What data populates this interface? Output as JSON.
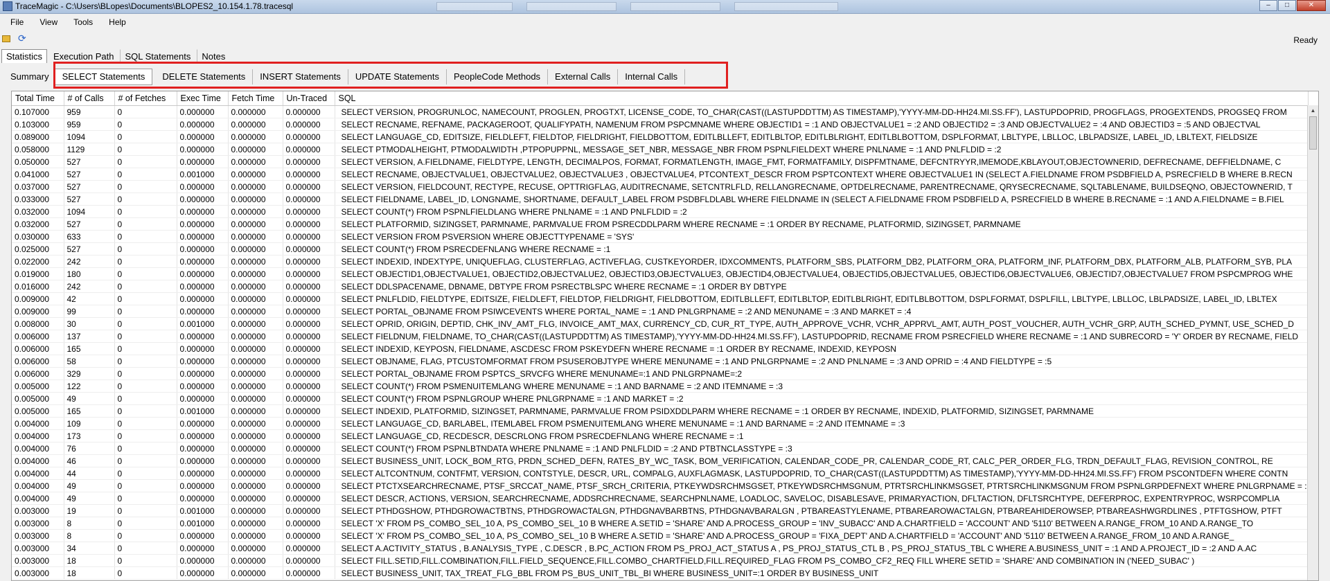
{
  "window": {
    "title": "TraceMagic - C:\\Users\\BLopes\\Documents\\BLOPES2_10.154.1.78.tracesql",
    "minimize": "–",
    "maximize": "□",
    "close": "✕"
  },
  "menu": [
    "File",
    "View",
    "Tools",
    "Help"
  ],
  "toolbar": {
    "open_icon": "folder-icon",
    "refresh_icon": "refresh-icon",
    "refresh_glyph": "⟳",
    "status": "Ready"
  },
  "top_tabs": [
    "Statistics",
    "Execution Path",
    "SQL Statements",
    "Notes"
  ],
  "sub_tabs": [
    "Summary",
    "SELECT Statements",
    "DELETE Statements",
    "INSERT Statements",
    "UPDATE Statements",
    "PeopleCode Methods",
    "External Calls",
    "Internal Calls"
  ],
  "grid": {
    "columns": [
      "Total Time",
      "# of Calls",
      "# of Fetches",
      "Exec Time",
      "Fetch Time",
      "Un-Traced",
      "SQL"
    ],
    "rows": [
      [
        "0.107000",
        "959",
        "0",
        "0.000000",
        "0.000000",
        "0.000000",
        "SELECT VERSION, PROGRUNLOC, NAMECOUNT, PROGLEN, PROGTXT, LICENSE_CODE, TO_CHAR(CAST((LASTUPDDTTM) AS TIMESTAMP),'YYYY-MM-DD-HH24.MI.SS.FF'), LASTUPDOPRID, PROGFLAGS, PROGEXTENDS, PROGSEQ FROM"
      ],
      [
        "0.103000",
        "959",
        "0",
        "0.000000",
        "0.000000",
        "0.000000",
        "SELECT RECNAME, REFNAME, PACKAGEROOT, QUALIFYPATH, NAMENUM FROM PSPCMNAME WHERE  OBJECTID1 = :1 AND OBJECTVALUE1 = :2 AND  OBJECTID2 = :3 AND OBJECTVALUE2 = :4 AND  OBJECTID3 = :5 AND OBJECTVAL"
      ],
      [
        "0.089000",
        "1094",
        "0",
        "0.000000",
        "0.000000",
        "0.000000",
        "SELECT LANGUAGE_CD, EDITSIZE, FIELDLEFT, FIELDTOP, FIELDRIGHT, FIELDBOTTOM, EDITLBLLEFT, EDITLBLTOP, EDITLBLRIGHT, EDITLBLBOTTOM, DSPLFORMAT, LBLTYPE, LBLLOC, LBLPADSIZE, LABEL_ID, LBLTEXT, FIELDSIZE"
      ],
      [
        "0.058000",
        "1129",
        "0",
        "0.000000",
        "0.000000",
        "0.000000",
        "SELECT PTMODALHEIGHT, PTMODALWIDTH   ,PTPOPUPPNL, MESSAGE_SET_NBR, MESSAGE_NBR FROM PSPNLFIELDEXT WHERE PNLNAME = :1 AND PNLFLDID = :2"
      ],
      [
        "0.050000",
        "527",
        "0",
        "0.000000",
        "0.000000",
        "0.000000",
        "SELECT VERSION, A.FIELDNAME, FIELDTYPE, LENGTH, DECIMALPOS, FORMAT, FORMATLENGTH, IMAGE_FMT, FORMATFAMILY, DISPFMTNAME, DEFCNTRYYR,IMEMODE,KBLAYOUT,OBJECTOWNERID, DEFRECNAME, DEFFIELDNAME, C"
      ],
      [
        "0.041000",
        "527",
        "0",
        "0.001000",
        "0.000000",
        "0.000000",
        "SELECT RECNAME, OBJECTVALUE1, OBJECTVALUE2,  OBJECTVALUE3 , OBJECTVALUE4, PTCONTEXT_DESCR FROM PSPTCONTEXT WHERE OBJECTVALUE1 IN (SELECT A.FIELDNAME FROM PSDBFIELD A, PSRECFIELD B WHERE B.RECN"
      ],
      [
        "0.037000",
        "527",
        "0",
        "0.000000",
        "0.000000",
        "0.000000",
        "SELECT VERSION, FIELDCOUNT, RECTYPE, RECUSE, OPTTRIGFLAG, AUDITRECNAME, SETCNTRLFLD, RELLANGRECNAME, OPTDELRECNAME, PARENTRECNAME, QRYSECRECNAME, SQLTABLENAME, BUILDSEQNO, OBJECTOWNERID, T"
      ],
      [
        "0.033000",
        "527",
        "0",
        "0.000000",
        "0.000000",
        "0.000000",
        "SELECT FIELDNAME, LABEL_ID, LONGNAME, SHORTNAME, DEFAULT_LABEL FROM PSDBFLDLABL WHERE FIELDNAME IN (SELECT A.FIELDNAME FROM PSDBFIELD A, PSRECFIELD B WHERE B.RECNAME = :1 AND A.FIELDNAME = B.FIEL"
      ],
      [
        "0.032000",
        "1094",
        "0",
        "0.000000",
        "0.000000",
        "0.000000",
        "SELECT COUNT(*)  FROM PSPNLFIELDLANG  WHERE PNLNAME = :1 AND PNLFLDID = :2"
      ],
      [
        "0.032000",
        "527",
        "0",
        "0.000000",
        "0.000000",
        "0.000000",
        "SELECT PLATFORMID, SIZINGSET, PARMNAME, PARMVALUE FROM PSRECDDLPARM WHERE RECNAME = :1 ORDER BY RECNAME, PLATFORMID, SIZINGSET, PARMNAME"
      ],
      [
        "0.030000",
        "633",
        "0",
        "0.000000",
        "0.000000",
        "0.000000",
        "SELECT VERSION FROM PSVERSION WHERE OBJECTTYPENAME = 'SYS'"
      ],
      [
        "0.025000",
        "527",
        "0",
        "0.000000",
        "0.000000",
        "0.000000",
        "SELECT COUNT(*) FROM PSRECDEFNLANG WHERE RECNAME = :1"
      ],
      [
        "0.022000",
        "242",
        "0",
        "0.000000",
        "0.000000",
        "0.000000",
        "SELECT INDEXID, INDEXTYPE, UNIQUEFLAG, CLUSTERFLAG, ACTIVEFLAG, CUSTKEYORDER, IDXCOMMENTS, PLATFORM_SBS, PLATFORM_DB2, PLATFORM_ORA, PLATFORM_INF, PLATFORM_DBX, PLATFORM_ALB, PLATFORM_SYB, PLA"
      ],
      [
        "0.019000",
        "180",
        "0",
        "0.000000",
        "0.000000",
        "0.000000",
        "SELECT OBJECTID1,OBJECTVALUE1, OBJECTID2,OBJECTVALUE2, OBJECTID3,OBJECTVALUE3, OBJECTID4,OBJECTVALUE4, OBJECTID5,OBJECTVALUE5, OBJECTID6,OBJECTVALUE6, OBJECTID7,OBJECTVALUE7  FROM PSPCMPROG WHE"
      ],
      [
        "0.016000",
        "242",
        "0",
        "0.000000",
        "0.000000",
        "0.000000",
        "SELECT DDLSPACENAME, DBNAME, DBTYPE FROM PSRECTBLSPC WHERE RECNAME = :1 ORDER BY DBTYPE"
      ],
      [
        "0.009000",
        "42",
        "0",
        "0.000000",
        "0.000000",
        "0.000000",
        "SELECT PNLFLDID, FIELDTYPE, EDITSIZE, FIELDLEFT, FIELDTOP, FIELDRIGHT, FIELDBOTTOM, EDITLBLLEFT, EDITLBLTOP, EDITLBLRIGHT, EDITLBLBOTTOM, DSPLFORMAT, DSPLFILL, LBLTYPE, LBLLOC, LBLPADSIZE, LABEL_ID, LBLTEX"
      ],
      [
        "0.009000",
        "99",
        "0",
        "0.000000",
        "0.000000",
        "0.000000",
        "SELECT PORTAL_OBJNAME FROM PSIWCEVENTS WHERE PORTAL_NAME = :1 AND PNLGRPNAME = :2 AND MENUNAME = :3 AND MARKET = :4"
      ],
      [
        "0.008000",
        "30",
        "0",
        "0.001000",
        "0.000000",
        "0.000000",
        "SELECT OPRID, ORIGIN, DEPTID, CHK_INV_AMT_FLG, INVOICE_AMT_MAX, CURRENCY_CD, CUR_RT_TYPE, AUTH_APPROVE_VCHR, VCHR_APPRVL_AMT, AUTH_POST_VOUCHER, AUTH_VCHR_GRP, AUTH_SCHED_PYMNT, USE_SCHED_D"
      ],
      [
        "0.006000",
        "137",
        "0",
        "0.000000",
        "0.000000",
        "0.000000",
        "SELECT FIELDNUM, FIELDNAME, TO_CHAR(CAST((LASTUPDDTTM) AS TIMESTAMP),'YYYY-MM-DD-HH24.MI.SS.FF'), LASTUPDOPRID, RECNAME FROM PSRECFIELD WHERE RECNAME = :1 AND SUBRECORD = 'Y' ORDER BY RECNAME, FIELD"
      ],
      [
        "0.006000",
        "165",
        "0",
        "0.000000",
        "0.000000",
        "0.000000",
        "SELECT INDEXID, KEYPOSN, FIELDNAME, ASCDESC FROM PSKEYDEFN WHERE RECNAME = :1 ORDER BY RECNAME, INDEXID, KEYPOSN"
      ],
      [
        "0.006000",
        "58",
        "0",
        "0.000000",
        "0.000000",
        "0.000000",
        "SELECT OBJNAME, FLAG, PTCUSTOMFORMAT FROM PSUSEROBJTYPE WHERE MENUNAME = :1 AND PNLGRPNAME = :2 AND PNLNAME = :3 AND OPRID = :4 AND FIELDTYPE = :5"
      ],
      [
        "0.006000",
        "329",
        "0",
        "0.000000",
        "0.000000",
        "0.000000",
        "SELECT PORTAL_OBJNAME FROM PSPTCS_SRVCFG WHERE MENUNAME=:1 AND PNLGRPNAME=:2"
      ],
      [
        "0.005000",
        "122",
        "0",
        "0.000000",
        "0.000000",
        "0.000000",
        "SELECT COUNT(*)  FROM PSMENUITEMLANG  WHERE MENUNAME = :1 AND BARNAME = :2 AND ITEMNAME = :3"
      ],
      [
        "0.005000",
        "49",
        "0",
        "0.000000",
        "0.000000",
        "0.000000",
        "SELECT COUNT(*)  FROM PSPNLGROUP WHERE PNLGRPNAME = :1 AND MARKET = :2"
      ],
      [
        "0.005000",
        "165",
        "0",
        "0.001000",
        "0.000000",
        "0.000000",
        "SELECT INDEXID, PLATFORMID, SIZINGSET, PARMNAME, PARMVALUE FROM PSIDXDDLPARM WHERE RECNAME = :1 ORDER BY RECNAME, INDEXID, PLATFORMID, SIZINGSET, PARMNAME"
      ],
      [
        "0.004000",
        "109",
        "0",
        "0.000000",
        "0.000000",
        "0.000000",
        "SELECT LANGUAGE_CD, BARLABEL, ITEMLABEL FROM PSMENUITEMLANG WHERE MENUNAME = :1 AND BARNAME = :2 AND ITEMNAME = :3"
      ],
      [
        "0.004000",
        "173",
        "0",
        "0.000000",
        "0.000000",
        "0.000000",
        "SELECT LANGUAGE_CD, RECDESCR, DESCRLONG FROM PSRECDEFNLANG WHERE RECNAME = :1"
      ],
      [
        "0.004000",
        "76",
        "0",
        "0.000000",
        "0.000000",
        "0.000000",
        "SELECT COUNT(*)  FROM PSPNLBTNDATA WHERE PNLNAME = :1 AND PNLFLDID = :2 AND PTBTNCLASSTYPE = :3"
      ],
      [
        "0.004000",
        "46",
        "0",
        "0.000000",
        "0.000000",
        "0.000000",
        "SELECT BUSINESS_UNIT, LOCK_BOM_RTG, PRDN_SCHED_DEFN, RATES_BY_WC_TASK, BOM_VERIFICATION, CALENDAR_CODE_PR, CALENDAR_CODE_RT, CALC_PER_ORDER_FLG, TRDN_DEFAULT_FLAG, REVISION_CONTROL, RE"
      ],
      [
        "0.004000",
        "44",
        "0",
        "0.000000",
        "0.000000",
        "0.000000",
        "SELECT ALTCONTNUM, CONTFMT, VERSION, CONTSTYLE, DESCR, URL, COMPALG, AUXFLAGMASK, LASTUPDOPRID, TO_CHAR(CAST((LASTUPDDTTM) AS TIMESTAMP),'YYYY-MM-DD-HH24.MI.SS.FF') FROM PSCONTDEFN WHERE CONTN"
      ],
      [
        "0.004000",
        "49",
        "0",
        "0.000000",
        "0.000000",
        "0.000000",
        "SELECT PTCTXSEARCHRECNAME, PTSF_SRCCAT_NAME, PTSF_SRCH_CRITERIA, PTKEYWDSRCHMSGSET, PTKEYWDSRCHMSGNUM, PTRTSRCHLINKMSGSET, PTRTSRCHLINKMSGNUM FROM PSPNLGRPDEFNEXT WHERE PNLGRPNAME = :"
      ],
      [
        "0.004000",
        "49",
        "0",
        "0.000000",
        "0.000000",
        "0.000000",
        "SELECT DESCR, ACTIONS, VERSION, SEARCHRECNAME, ADDSRCHRECNAME,  SEARCHPNLNAME, LOADLOC, SAVELOC, DISABLESAVE, PRIMARYACTION, DFLTACTION, DFLTSRCHTYPE,  DEFERPROC, EXPENTRYPROC, WSRPCOMPLIA"
      ],
      [
        "0.003000",
        "19",
        "0",
        "0.001000",
        "0.000000",
        "0.000000",
        "SELECT PTHDGSHOW, PTHDGROWACTBTNS, PTHDGROWACTALGN, PTHDGNAVBARBTNS, PTHDGNAVBARALGN    , PTBAREASTYLENAME, PTBAREAROWACTALGN, PTBAREAHIDEROWSEP, PTBAREASHWGRDLINES    , PTFTGSHOW, PTFT"
      ],
      [
        "0.003000",
        "8",
        "0",
        "0.001000",
        "0.000000",
        "0.000000",
        "SELECT  'X'  FROM    PS_COMBO_SEL_10 A,  PS_COMBO_SEL_10 B WHERE A.SETID = 'SHARE' AND A.PROCESS_GROUP = 'INV_SUBACC' AND A.CHARTFIELD   = 'ACCOUNT' AND '5110' BETWEEN A.RANGE_FROM_10 AND A.RANGE_TO"
      ],
      [
        "0.003000",
        "8",
        "0",
        "0.000000",
        "0.000000",
        "0.000000",
        "SELECT  'X' FROM    PS_COMBO_SEL_10 A,  PS_COMBO_SEL_10 B WHERE A.SETID = 'SHARE' AND A.PROCESS_GROUP = 'FIXA_DEPT' AND A.CHARTFIELD   = 'ACCOUNT' AND '5110' BETWEEN A.RANGE_FROM_10 AND A.RANGE_"
      ],
      [
        "0.003000",
        "34",
        "0",
        "0.000000",
        "0.000000",
        "0.000000",
        "SELECT A.ACTIVITY_STATUS , B.ANALYSIS_TYPE , C.DESCR , B.PC_ACTION FROM PS_PROJ_ACT_STATUS A , PS_PROJ_STATUS_CTL B , PS_PROJ_STATUS_TBL C WHERE A.BUSINESS_UNIT = :1 AND A.PROJECT_ID = :2 AND A.AC"
      ],
      [
        "0.003000",
        "18",
        "0",
        "0.000000",
        "0.000000",
        "0.000000",
        "SELECT FILL.SETID,FILL.COMBINATION,FILL.FIELD_SEQUENCE,FILL.COMBO_CHARTFIELD,FILL.REQUIRED_FLAG FROM PS_COMBO_CF2_REQ FILL  WHERE SETID = 'SHARE' AND COMBINATION IN ('NEED_SUBAC' )"
      ],
      [
        "0.003000",
        "18",
        "0",
        "0.000000",
        "0.000000",
        "0.000000",
        "SELECT BUSINESS_UNIT, TAX_TREAT_FLG_BBL FROM PS_BUS_UNIT_TBL_BI WHERE BUSINESS_UNIT=:1 ORDER BY BUSINESS_UNIT"
      ]
    ]
  },
  "scrollbar": {
    "up_glyph": "▲"
  }
}
